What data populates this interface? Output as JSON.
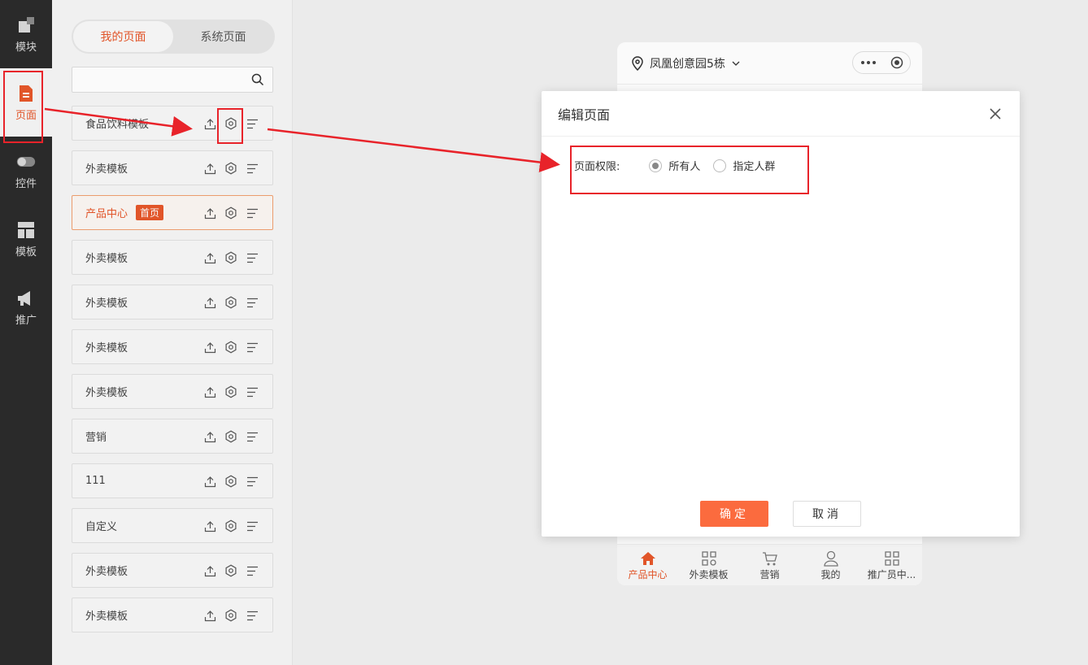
{
  "nav": {
    "items": [
      {
        "label": "模块",
        "icon": "blocks-icon"
      },
      {
        "label": "页面",
        "icon": "page-icon"
      },
      {
        "label": "控件",
        "icon": "toggle-icon"
      },
      {
        "label": "模板",
        "icon": "template-icon"
      },
      {
        "label": "推广",
        "icon": "megaphone-icon"
      }
    ]
  },
  "panel": {
    "tabs": [
      "我的页面",
      "系统页面"
    ],
    "search_placeholder": "",
    "pages": [
      {
        "label": "食品饮料模板",
        "badge": ""
      },
      {
        "label": "外卖模板",
        "badge": ""
      },
      {
        "label": "产品中心",
        "badge": "首页"
      },
      {
        "label": "外卖模板",
        "badge": ""
      },
      {
        "label": "外卖模板",
        "badge": ""
      },
      {
        "label": "外卖模板",
        "badge": ""
      },
      {
        "label": "外卖模板",
        "badge": ""
      },
      {
        "label": "营销",
        "badge": ""
      },
      {
        "label": "111",
        "badge": ""
      },
      {
        "label": "自定义",
        "badge": ""
      },
      {
        "label": "外卖模板",
        "badge": ""
      },
      {
        "label": "外卖模板",
        "badge": ""
      }
    ]
  },
  "phone": {
    "location": "凤凰创意园5栋",
    "tabs": [
      "产品中心",
      "外卖模板",
      "营销",
      "我的",
      "推广员中..."
    ]
  },
  "dialog": {
    "title": "编辑页面",
    "perm_label": "页面权限:",
    "options": [
      "所有人",
      "指定人群"
    ],
    "selected": "所有人",
    "ok": "确定",
    "cancel": "取消"
  },
  "colors": {
    "accent": "#e6572a",
    "button": "#fb6b3e",
    "annotation": "#e8232a",
    "nav_bg": "#2b2b2b"
  }
}
